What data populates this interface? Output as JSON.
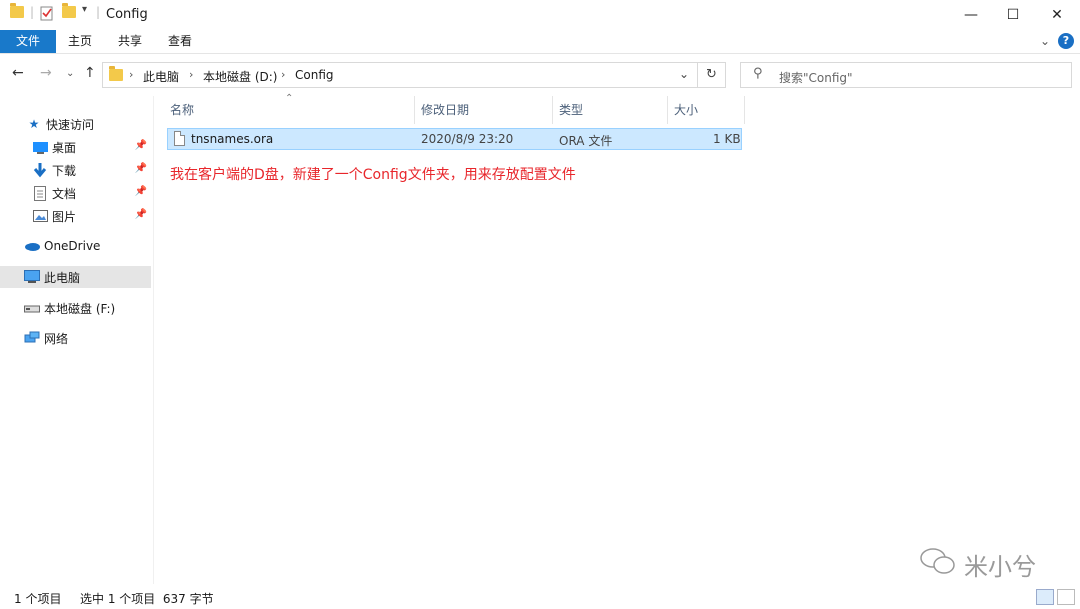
{
  "window": {
    "title": "Config",
    "minimize_glyph": "—",
    "maximize_glyph": "☐",
    "close_glyph": "✕"
  },
  "ribbon": {
    "tabs": [
      "文件",
      "主页",
      "共享",
      "查看"
    ],
    "help": "?"
  },
  "address": {
    "crumbs": [
      "此电脑",
      "本地磁盘 (D:)",
      "Config"
    ],
    "search_placeholder": "搜索\"Config\""
  },
  "nav_pane": {
    "quick_access": "快速访问",
    "quick_items": [
      {
        "label": "桌面",
        "icon": "desktop-icon"
      },
      {
        "label": "下载",
        "icon": "download-icon"
      },
      {
        "label": "文档",
        "icon": "document-icon"
      },
      {
        "label": "图片",
        "icon": "pictures-icon"
      }
    ],
    "onedrive": "OneDrive",
    "this_pc": "此电脑",
    "drive_f": "本地磁盘 (F:)",
    "network": "网络"
  },
  "columns": [
    "名称",
    "修改日期",
    "类型",
    "大小"
  ],
  "files": [
    {
      "name": "tnsnames.ora",
      "modified": "2020/8/9 23:20",
      "type": "ORA 文件",
      "size": "1 KB"
    }
  ],
  "annotation": "我在客户端的D盘，新建了一个Config文件夹，用来存放配置文件",
  "status": {
    "count": "1 个项目",
    "selected": "选中 1 个项目  637 字节"
  },
  "watermark": "米小兮"
}
